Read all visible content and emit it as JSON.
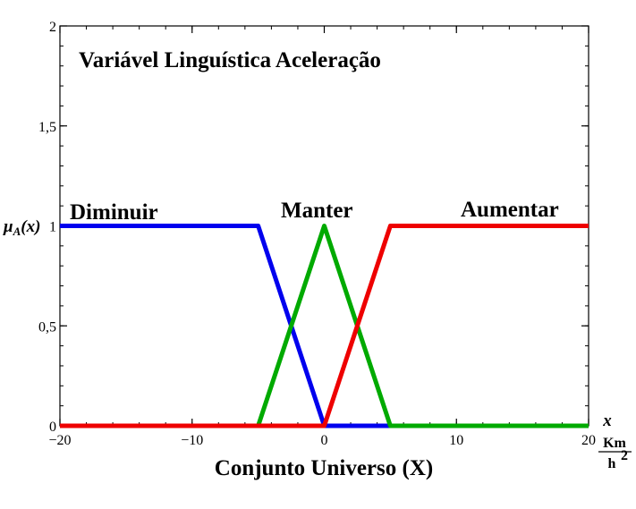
{
  "chart_data": {
    "type": "line",
    "title": "Variável Linguística Aceleração",
    "xlabel": "Conjunto Universo (X)",
    "ylabel": "μA(x)",
    "ylabel_main": "μ",
    "ylabel_sub": "A",
    "ylabel_tail": "(x)",
    "x_unit_symbol": "x",
    "x_unit_numerator": "Km",
    "x_unit_denominator": "h",
    "x_unit_exponent": "2",
    "xlim": [
      -20,
      20
    ],
    "ylim": [
      0,
      2
    ],
    "x_ticks": [
      {
        "value": -20,
        "label": "−20"
      },
      {
        "value": -10,
        "label": "−10"
      },
      {
        "value": 0,
        "label": "0"
      },
      {
        "value": 10,
        "label": "10"
      },
      {
        "value": 20,
        "label": "20"
      }
    ],
    "y_ticks": [
      {
        "value": 0,
        "label": "0"
      },
      {
        "value": 0.5,
        "label": "0,5"
      },
      {
        "value": 1,
        "label": "1"
      },
      {
        "value": 1.5,
        "label": "1,5"
      },
      {
        "value": 2,
        "label": "2"
      }
    ],
    "grid": false,
    "series": [
      {
        "name": "Diminuir",
        "color": "#0000ee",
        "points": [
          [
            -20,
            1
          ],
          [
            -5,
            1
          ],
          [
            0,
            0
          ],
          [
            20,
            0
          ]
        ]
      },
      {
        "name": "Manter",
        "color": "#00aa00",
        "points": [
          [
            -20,
            0
          ],
          [
            -5,
            0
          ],
          [
            0,
            1
          ],
          [
            5,
            0
          ],
          [
            20,
            0
          ]
        ]
      },
      {
        "name": "Aumentar",
        "color": "#ee0000",
        "points": [
          [
            -20,
            0
          ],
          [
            0,
            0
          ],
          [
            5,
            1
          ],
          [
            20,
            1
          ]
        ]
      }
    ]
  }
}
